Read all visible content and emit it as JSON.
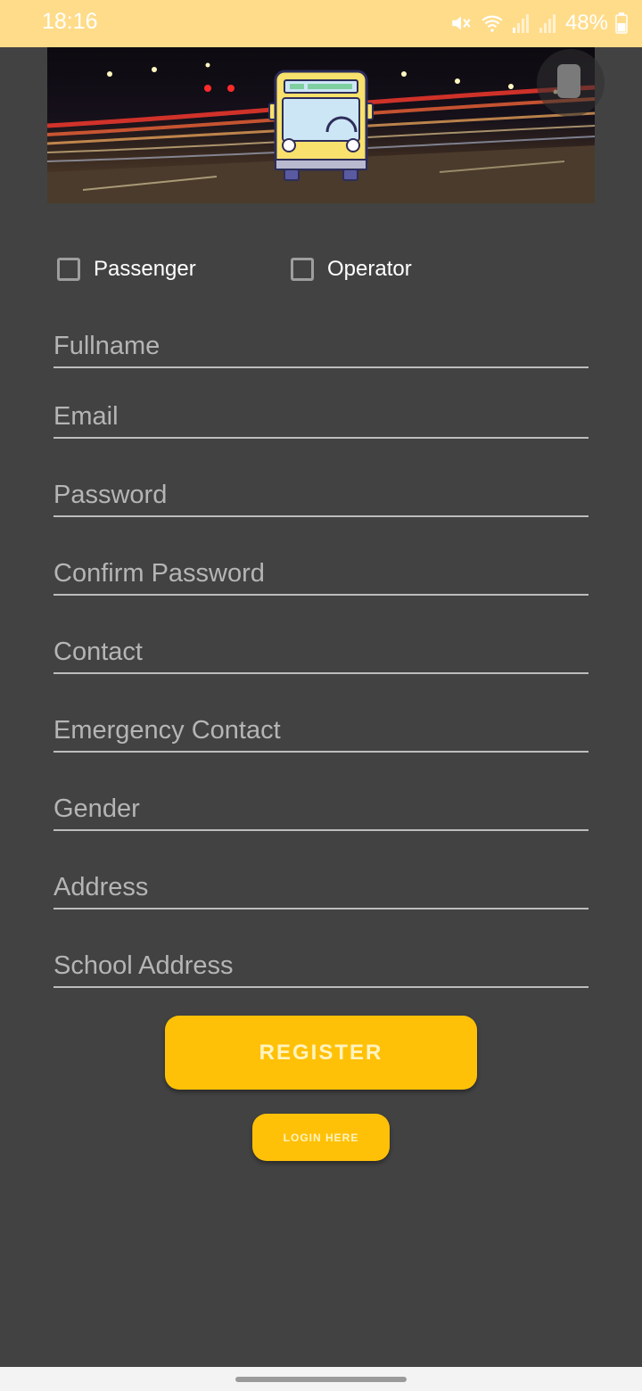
{
  "status_bar": {
    "time": "18:16",
    "battery": "48%",
    "icons": [
      "mute-icon",
      "wifi-icon",
      "signal-icon",
      "signal-icon",
      "battery-icon"
    ]
  },
  "banner": {
    "image": "night-traffic-with-bus-logo",
    "bus_color": "#F8E16C"
  },
  "role": {
    "passenger_label": "Passenger",
    "operator_label": "Operator",
    "passenger_checked": false,
    "operator_checked": false
  },
  "fields": {
    "fullname": "Fullname",
    "email": "Email",
    "password": "Password",
    "confirm_password": "Confirm Password",
    "contact": "Contact",
    "emergency_contact": "Emergency Contact",
    "gender": "Gender",
    "address": "Address",
    "school_address": "School Address"
  },
  "buttons": {
    "register": "REGISTER",
    "login": "LOGIN HERE"
  },
  "colors": {
    "accent": "#FFC107",
    "status_bar": "#FFDC8A",
    "background": "#424242"
  }
}
